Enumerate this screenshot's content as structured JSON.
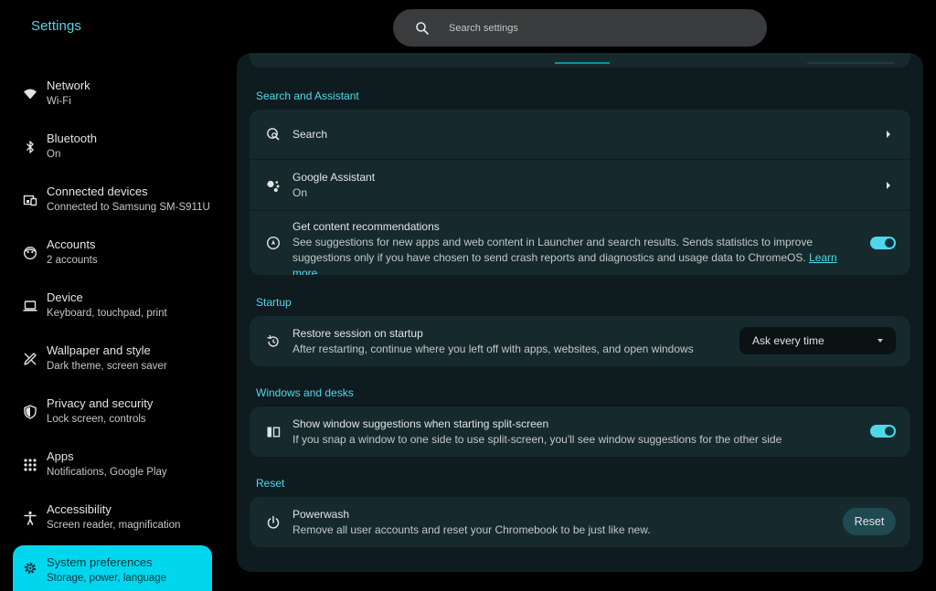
{
  "app": {
    "title": "Settings"
  },
  "search": {
    "placeholder": "Search settings",
    "icon": "search-icon"
  },
  "sidebar": {
    "items": [
      {
        "label": "Network",
        "sub": "Wi-Fi",
        "icon": "wifi-icon"
      },
      {
        "label": "Bluetooth",
        "sub": "On",
        "icon": "bluetooth-icon"
      },
      {
        "label": "Connected devices",
        "sub": "Connected to Samsung SM-S911U",
        "icon": "devices-icon"
      },
      {
        "label": "Accounts",
        "sub": "2 accounts",
        "icon": "accounts-icon"
      },
      {
        "label": "Device",
        "sub": "Keyboard, touchpad, print",
        "icon": "laptop-icon"
      },
      {
        "label": "Wallpaper and style",
        "sub": "Dark theme, screen saver",
        "icon": "palette-icon"
      },
      {
        "label": "Privacy and security",
        "sub": "Lock screen, controls",
        "icon": "shield-icon"
      },
      {
        "label": "Apps",
        "sub": "Notifications, Google Play",
        "icon": "apps-grid-icon"
      },
      {
        "label": "Accessibility",
        "sub": "Screen reader, magnification",
        "icon": "accessibility-icon"
      },
      {
        "label": "System preferences",
        "sub": "Storage, power, language",
        "icon": "gear-icon",
        "active": true
      }
    ]
  },
  "sections": {
    "search_assistant": {
      "header": "Search and Assistant",
      "search": {
        "title": "Search"
      },
      "assistant": {
        "title": "Google Assistant",
        "desc": "On"
      },
      "recommendations": {
        "title": "Get content recommendations",
        "desc": "See suggestions for new apps and web content in Launcher and search results. Sends statistics to improve suggestions only if you have chosen to send crash reports and diagnostics and usage data to ChromeOS.",
        "link": "Learn more",
        "enabled": true
      }
    },
    "startup": {
      "header": "Startup",
      "restore": {
        "title": "Restore session on startup",
        "desc": "After restarting, continue where you left off with apps, websites, and open windows",
        "selected": "Ask every time"
      }
    },
    "windows": {
      "header": "Windows and desks",
      "split": {
        "title": "Show window suggestions when starting split-screen",
        "desc": "If you snap a window to one side to use split-screen, you'll see window suggestions for the other side",
        "enabled": true
      }
    },
    "reset": {
      "header": "Reset",
      "powerwash": {
        "title": "Powerwash",
        "desc": "Remove all user accounts and reset your Chromebook to be just like new.",
        "button": "Reset"
      }
    }
  },
  "colors": {
    "accent": "#4fd8eb",
    "active_bg": "#00d7ee",
    "card_bg": "#162a2e",
    "panel_bg": "#0e1c1f"
  }
}
